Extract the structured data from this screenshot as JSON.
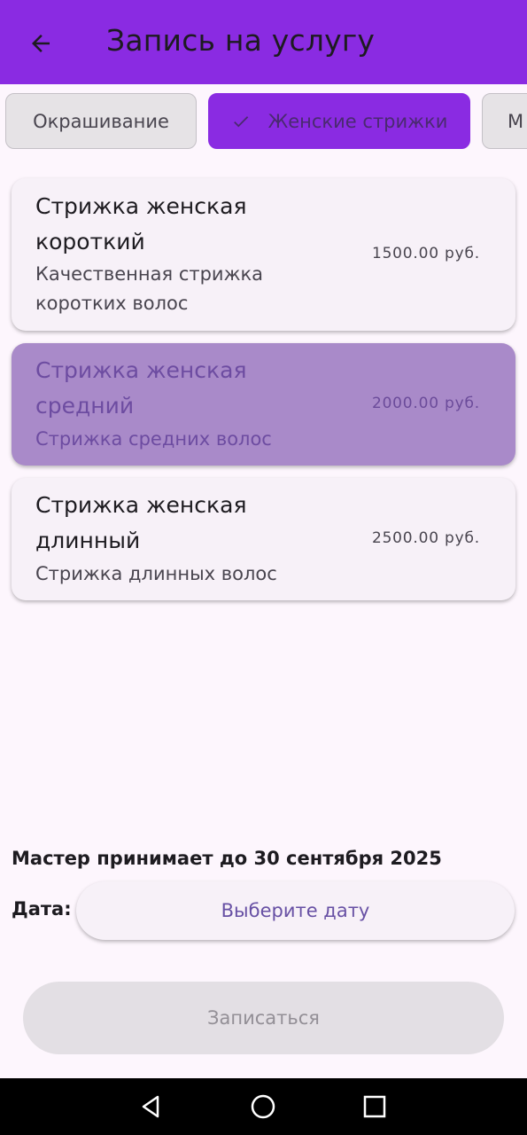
{
  "app_bar": {
    "title": "Запись на услугу",
    "background_color": "#8a2be2",
    "back_icon": "arrow-back-icon"
  },
  "categories": [
    {
      "label": "Окрашивание",
      "selected": false
    },
    {
      "label": "Женские стрижки",
      "selected": true
    },
    {
      "label": "М",
      "selected": false
    }
  ],
  "services": [
    {
      "name_line1": "Стрижка женская",
      "name_line2": "короткий",
      "desc_line1": "Качественная стрижка",
      "desc_line2": "коротких волос",
      "price": "1500.00 руб.",
      "selected": false
    },
    {
      "name_line1": "Стрижка женская",
      "name_line2": "средний",
      "desc_line1": "Стрижка средних волос",
      "price": "2000.00 руб.",
      "selected": true
    },
    {
      "name_line1": "Стрижка женская",
      "name_line2": "длинный",
      "desc_line1": "Стрижка длинных волос",
      "price": "2500.00 руб.",
      "selected": false
    }
  ],
  "booking": {
    "master_note": "Мастер принимает до 30 сентября 2025",
    "date_label": "Дата:",
    "date_button": "Выберите дату",
    "submit_button": "Записаться"
  },
  "nav_bar": {
    "icons": [
      "back-triangle-icon",
      "home-circle-icon",
      "recents-square-icon"
    ]
  }
}
